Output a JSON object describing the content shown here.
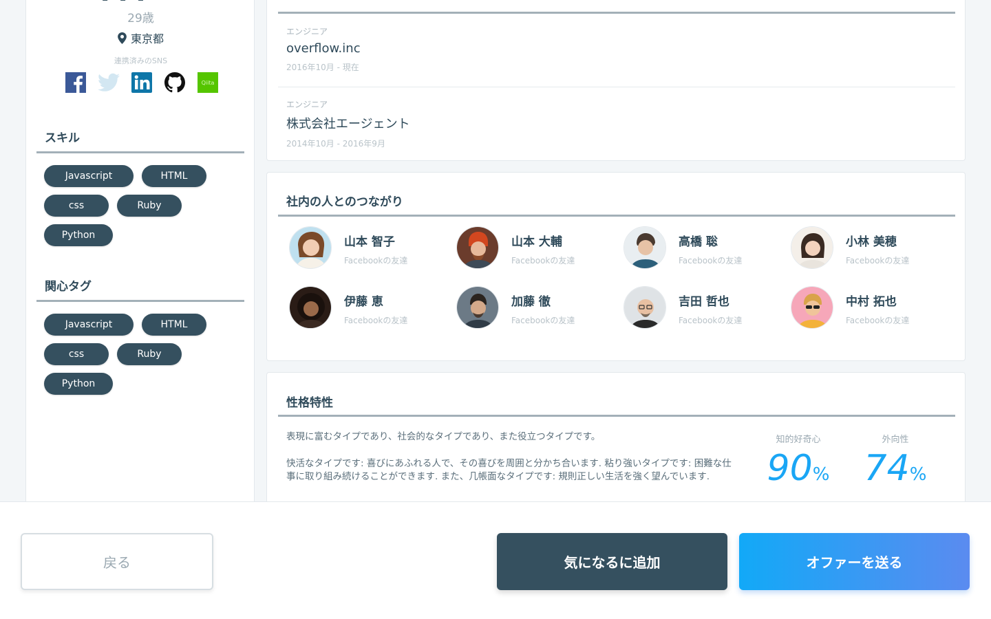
{
  "profile": {
    "age": "29歳",
    "location": "東京都",
    "sns_label": "連携済みのSNS",
    "sns": [
      {
        "name": "facebook",
        "icon": "facebook-icon"
      },
      {
        "name": "twitter",
        "icon": "twitter-icon"
      },
      {
        "name": "linkedin",
        "icon": "linkedin-icon"
      },
      {
        "name": "github",
        "icon": "github-icon"
      },
      {
        "name": "qiita",
        "icon": "qiita-icon",
        "label": "Qiita"
      }
    ]
  },
  "skills": {
    "title": "スキル",
    "tags": [
      "Javascript",
      "HTML",
      "css",
      "Ruby",
      "Python"
    ]
  },
  "interests": {
    "title": "関心タグ",
    "tags": [
      "Javascript",
      "HTML",
      "css",
      "Ruby",
      "Python"
    ]
  },
  "career": {
    "entries": [
      {
        "role": "エンジニア",
        "company": "overflow.inc",
        "period": "2016年10月 - 現在"
      },
      {
        "role": "エンジニア",
        "company": "株式会社エージェント",
        "period": "2014年10月 - 2016年9月"
      }
    ]
  },
  "connections": {
    "title": "社内の人とのつながり",
    "people": [
      {
        "name": "山本 智子",
        "relation": "Facebookの友達"
      },
      {
        "name": "山本 大輔",
        "relation": "Facebookの友達"
      },
      {
        "name": "高橋 聡",
        "relation": "Facebookの友達"
      },
      {
        "name": "小林 美穂",
        "relation": "Facebookの友達"
      },
      {
        "name": "伊藤 恵",
        "relation": "Facebookの友達"
      },
      {
        "name": "加藤 徹",
        "relation": "Facebookの友達"
      },
      {
        "name": "吉田 哲也",
        "relation": "Facebookの友達"
      },
      {
        "name": "中村 拓也",
        "relation": "Facebookの友達"
      }
    ]
  },
  "personality": {
    "title": "性格特性",
    "paragraph1": "表現に富むタイプであり、社会的なタイプであり、また役立つタイプです。",
    "paragraph2": "快活なタイプです: 喜びにあふれる人で、その喜びを周囲と分かち合います. 粘り強いタイプです: 困難な仕事に取り組み続けることができます. また、几帳面なタイプです: 規則正しい生活を強く望んでいます.",
    "metrics": [
      {
        "label": "知的好奇心",
        "value": "90",
        "unit": "%"
      },
      {
        "label": "外向性",
        "value": "74",
        "unit": "%"
      }
    ]
  },
  "actions": {
    "back": "戻る",
    "favorite": "気になるに追加",
    "offer": "オファーを送る"
  },
  "colors": {
    "tag_bg": "#35505f",
    "accent": "#1aa6f5",
    "offer_gradient_start": "#12a9f7",
    "offer_gradient_end": "#5b8bf0"
  }
}
